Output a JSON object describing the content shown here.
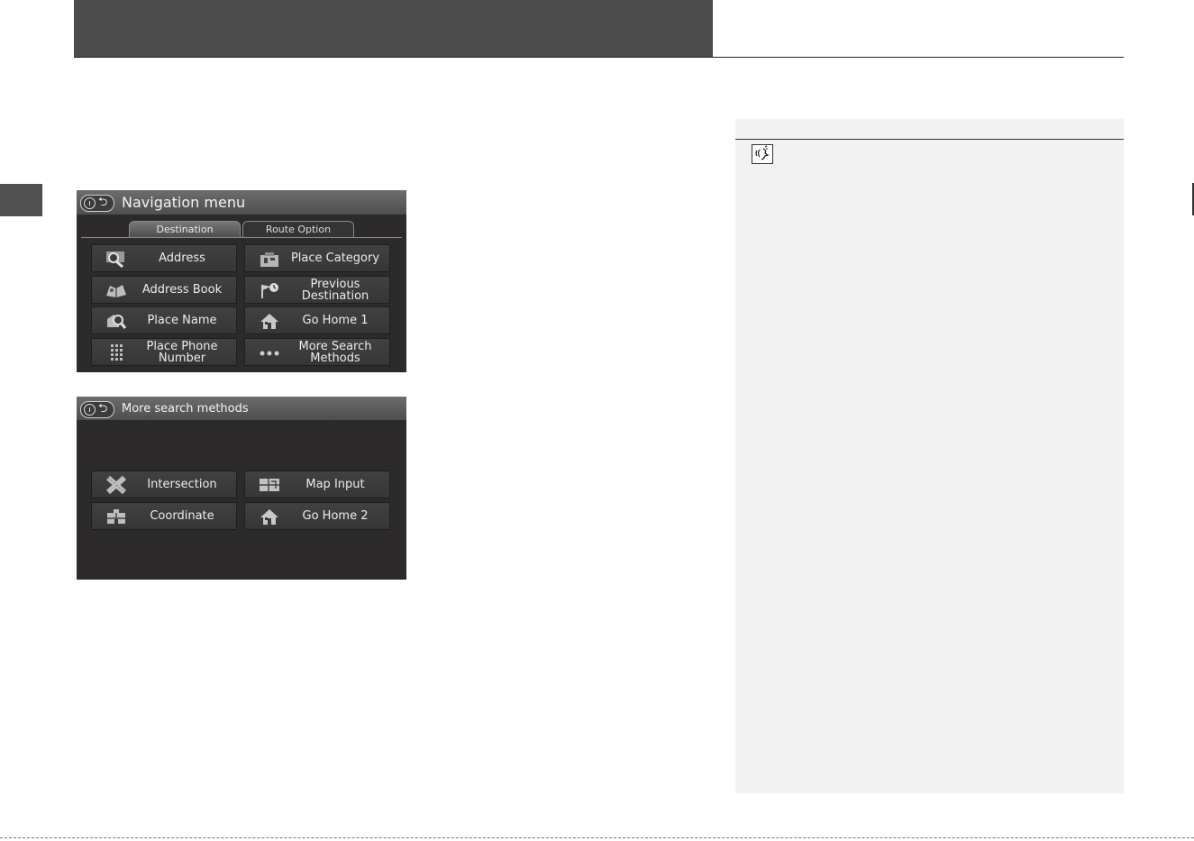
{
  "screen_1": {
    "title": "Navigation menu",
    "tabs": [
      {
        "label": "Destination"
      },
      {
        "label": "Route Option"
      }
    ],
    "buttons": [
      {
        "label": "Address",
        "icon": "magnifier-icon"
      },
      {
        "label": "Place Category",
        "icon": "category-icon"
      },
      {
        "label": "Address Book",
        "icon": "address-book-icon"
      },
      {
        "label": "Previous Destination",
        "icon": "previous-destination-icon"
      },
      {
        "label": "Place Name",
        "icon": "place-name-icon"
      },
      {
        "label": "Go Home 1",
        "icon": "home-icon"
      },
      {
        "label": "Place Phone Number",
        "icon": "keypad-icon"
      },
      {
        "label": "More Search Methods",
        "icon": "more-icon"
      }
    ]
  },
  "screen_2": {
    "title": "More search methods",
    "buttons": [
      {
        "label": "Intersection",
        "icon": "intersection-icon"
      },
      {
        "label": "Map Input",
        "icon": "map-icon"
      },
      {
        "label": "Coordinate",
        "icon": "coordinate-icon"
      },
      {
        "label": "Go Home 2",
        "icon": "home-icon"
      }
    ]
  },
  "colors": {
    "header": "#4b4b4b",
    "screen_bg": "#2c2a2b",
    "side_panel": "#f2f2f2"
  }
}
